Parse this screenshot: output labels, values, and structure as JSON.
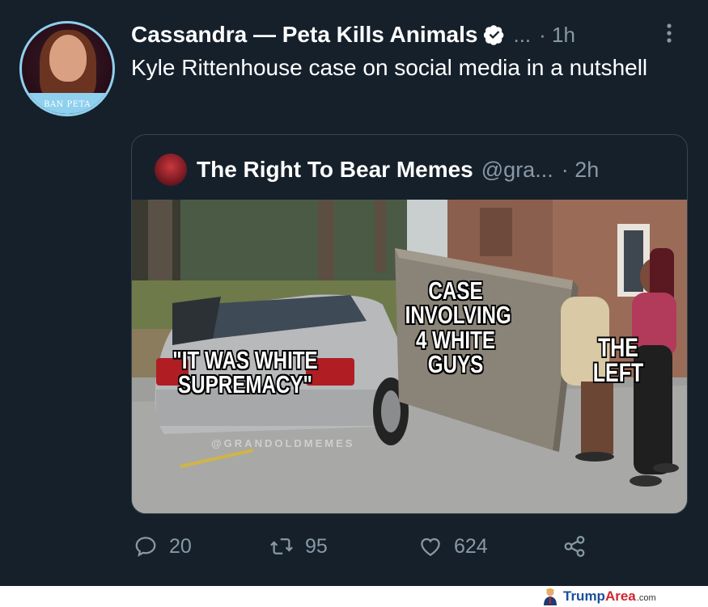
{
  "tweet": {
    "author": "Cassandra — Peta Kills Animals",
    "ellipsis": "...",
    "time": "· 1h",
    "text": "Kyle Rittenhouse case on social media in a nutshell",
    "avatar_badge": "BAN PETA"
  },
  "quoted": {
    "name": "The Right To Bear Memes",
    "handle": "@gra...",
    "time": "· 2h",
    "meme": {
      "caption_car": "\"IT WAS WHITE SUPREMACY\"",
      "caption_mattress": "CASE INVOLVING 4 WHITE GUYS",
      "caption_person": "THE LEFT",
      "watermark": "@GRANDOLDMEMES"
    }
  },
  "actions": {
    "replies": "20",
    "retweets": "95",
    "likes": "624"
  },
  "site": {
    "brand_part1": "Trump",
    "brand_part2": "Area",
    "brand_tld": ".com"
  },
  "colors": {
    "background": "#15202b",
    "secondary_text": "#8899a6",
    "border": "#38444d",
    "verified": "#ffffff"
  },
  "icons": [
    "verified-badge-icon",
    "more-icon",
    "reply-icon",
    "retweet-icon",
    "like-icon",
    "share-icon"
  ]
}
